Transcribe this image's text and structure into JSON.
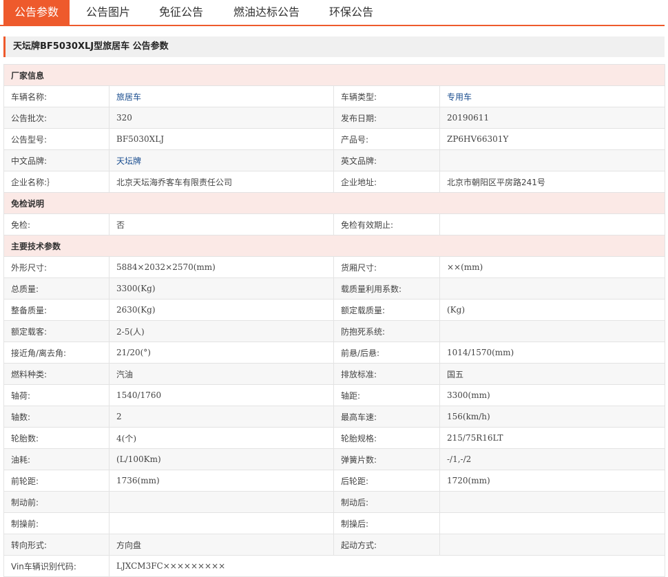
{
  "tabs": [
    "公告参数",
    "公告图片",
    "免征公告",
    "燃油达标公告",
    "环保公告"
  ],
  "page_title": "天坛牌BF5030XLJ型旅居车 公告参数",
  "sections": {
    "manufacturer": "厂家信息",
    "exemption": "免检说明",
    "tech": "主要技术参数"
  },
  "manufacturer_rows": [
    {
      "l1": "车辆名称:",
      "v1": "旅居车",
      "l2": "车辆类型:",
      "v2": "专用车"
    },
    {
      "l1": "公告批次:",
      "v1": "320",
      "l2": "发布日期:",
      "v2": "20190611"
    },
    {
      "l1": "公告型号:",
      "v1": "BF5030XLJ",
      "l2": "产品号:",
      "v2": "ZP6HV66301Y"
    },
    {
      "l1": "中文品牌:",
      "v1": "天坛牌",
      "l2": "英文品牌:",
      "v2": ""
    },
    {
      "l1": "企业名称:｝",
      "v1": "北京天坛海乔客车有限责任公司",
      "l2": "企业地址:",
      "v2": "北京市朝阳区平房路241号"
    }
  ],
  "exemption_rows": [
    {
      "l1": "免检:",
      "v1": "否",
      "l2": "免检有效期止:",
      "v2": ""
    }
  ],
  "tech_rows": [
    {
      "l1": "外形尺寸:",
      "v1": "5884×2032×2570(mm)",
      "l2": "货厢尺寸:",
      "v2": "××(mm)"
    },
    {
      "l1": "总质量:",
      "v1": "3300(Kg)",
      "l2": "载质量利用系数:",
      "v2": ""
    },
    {
      "l1": "整备质量:",
      "v1": "2630(Kg)",
      "l2": "额定载质量:",
      "v2": "(Kg)"
    },
    {
      "l1": "额定载客:",
      "v1": "2-5(人)",
      "l2": "防抱死系统:",
      "v2": ""
    },
    {
      "l1": "接近角/离去角:",
      "v1": "21/20(°)",
      "l2": "前悬/后悬:",
      "v2": "1014/1570(mm)"
    },
    {
      "l1": "燃料种类:",
      "v1": "汽油",
      "l2": "排放标准:",
      "v2": "国五"
    },
    {
      "l1": "轴荷:",
      "v1": "1540/1760",
      "l2": "轴距:",
      "v2": "3300(mm)"
    },
    {
      "l1": "轴数:",
      "v1": "2",
      "l2": "最高车速:",
      "v2": "156(km/h)"
    },
    {
      "l1": "轮胎数:",
      "v1": "4(个)",
      "l2": "轮胎规格:",
      "v2": "215/75R16LT"
    },
    {
      "l1": "油耗:",
      "v1": "(L/100Km)",
      "l2": "弹簧片数:",
      "v2": "-/1,-/2"
    },
    {
      "l1": "前轮距:",
      "v1": "1736(mm)",
      "l2": "后轮距:",
      "v2": "1720(mm)"
    },
    {
      "l1": "制动前:",
      "v1": "",
      "l2": "制动后:",
      "v2": ""
    },
    {
      "l1": "制操前:",
      "v1": "",
      "l2": "制操后:",
      "v2": ""
    },
    {
      "l1": "转向形式:",
      "v1": "方向盘",
      "l2": "起动方式:",
      "v2": ""
    }
  ],
  "vin": {
    "label": "Vin车辆识别代码:",
    "value": "LJXCM3FC×××××××××"
  },
  "colors": {
    "accent": "#ee5a2c",
    "section_bg": "#fbe9e6",
    "link": "#1a4d8f"
  }
}
